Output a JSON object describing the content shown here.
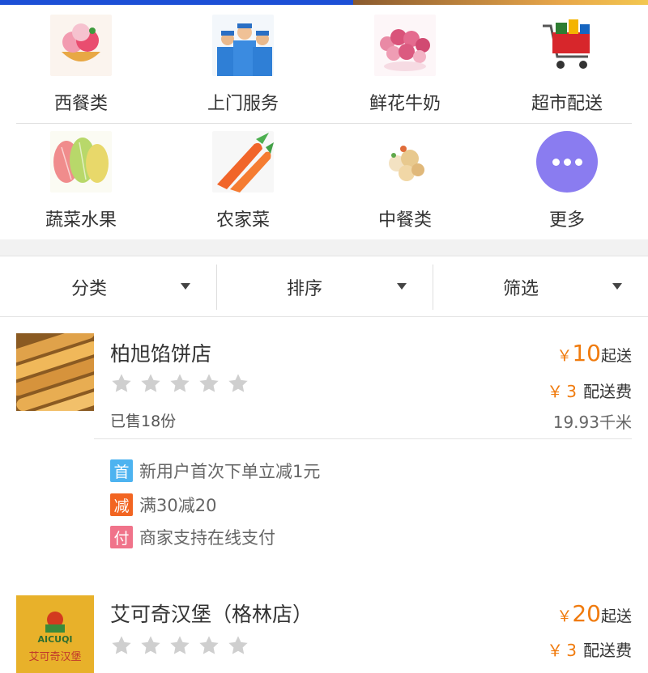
{
  "categories": [
    {
      "label": "西餐类",
      "icon": "ice-cream-dessert-image"
    },
    {
      "label": "上门服务",
      "icon": "service-workers-image"
    },
    {
      "label": "鲜花牛奶",
      "icon": "roses-bouquet-image"
    },
    {
      "label": "超市配送",
      "icon": "shopping-cart-image"
    },
    {
      "label": "蔬菜水果",
      "icon": "apples-fruit-image"
    },
    {
      "label": "农家菜",
      "icon": "carrots-image"
    },
    {
      "label": "中餐类",
      "icon": "chinese-dish-image"
    },
    {
      "label": "更多",
      "icon": "more-dots-icon"
    }
  ],
  "filters": {
    "category": "分类",
    "sort": "排序",
    "filter": "筛选"
  },
  "shops": [
    {
      "name": "柏旭馅饼店",
      "rating": 0,
      "sold": "已售18份",
      "currency": "￥",
      "min_order": "10",
      "min_order_suffix": "起送",
      "delivery_fee": "3",
      "delivery_fee_suffix": "配送费",
      "distance": "19.93千米",
      "promos": [
        {
          "tag": "首",
          "text": "新用户首次下单立减1元",
          "color": "#4db3f0"
        },
        {
          "tag": "减",
          "text": "满30减20",
          "color": "#f26522"
        },
        {
          "tag": "付",
          "text": "商家支持在线支付",
          "color": "#f0738a"
        }
      ]
    },
    {
      "name": "艾可奇汉堡（格林店）",
      "rating": 0,
      "logo_text": "AICUQI",
      "logo_text2": "艾可奇汉堡",
      "currency": "￥",
      "min_order": "20",
      "min_order_suffix": "起送",
      "delivery_fee": "3",
      "delivery_fee_suffix": "配送费"
    }
  ],
  "colors": {
    "accent": "#f07b0e",
    "more_circle": "#8a7cf0"
  }
}
